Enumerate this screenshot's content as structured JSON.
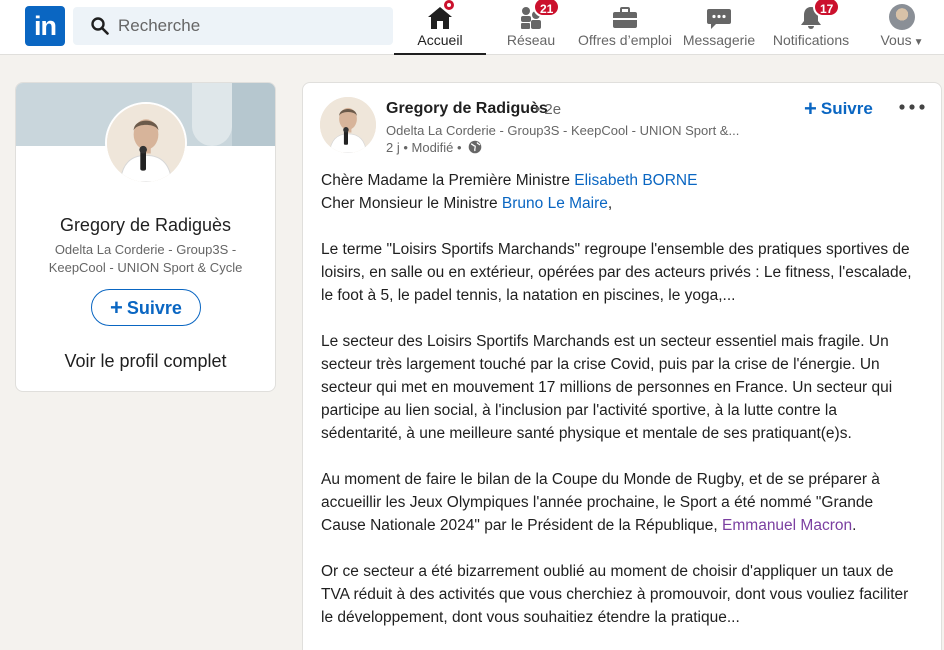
{
  "nav": {
    "search_placeholder": "Recherche",
    "items": [
      {
        "label": "Accueil",
        "icon": "home-icon",
        "active": true
      },
      {
        "label": "Réseau",
        "icon": "network-icon",
        "badge": "21"
      },
      {
        "label": "Offres d’emploi",
        "icon": "briefcase-icon"
      },
      {
        "label": "Messagerie",
        "icon": "messaging-icon"
      },
      {
        "label": "Notifications",
        "icon": "bell-icon",
        "badge": "17"
      },
      {
        "label": "Vous",
        "icon": "avatar-icon"
      }
    ]
  },
  "profile_card": {
    "name": "Gregory de Radiguès",
    "headline": "Odelta La Corderie - Group3S - KeepCool - UNION Sport & Cycle",
    "follow_label": "Suivre",
    "view_full_profile": "Voir le profil complet"
  },
  "post": {
    "author": "Gregory de Radiguès",
    "degree": "• 2e",
    "headline": "Odelta La Corderie - Group3S - KeepCool - UNION Sport &...",
    "meta": "2 j • Modifié •",
    "follow_label": "Suivre",
    "greeting_1_prefix": "Chère Madame la Première Ministre ",
    "greeting_1_mention": "Elisabeth BORNE",
    "greeting_2_prefix": "Cher Monsieur le Ministre ",
    "greeting_2_mention": "Bruno Le Maire",
    "greeting_2_suffix": ",",
    "paragraph_1": "Le terme \"Loisirs Sportifs Marchands\" regroupe l'ensemble des pratiques sportives de loisirs, en salle ou en extérieur, opérées par des acteurs privés : Le fitness, l'escalade, le foot à 5, le padel tennis, la natation en piscines, le yoga,...",
    "paragraph_2": "Le secteur des Loisirs Sportifs Marchands est un secteur essentiel mais fragile. Un secteur très largement touché par la crise Covid, puis par la crise de l'énergie. Un secteur qui met en mouvement 17 millions de personnes en France. Un secteur qui participe au lien social, à l'inclusion par l'activité sportive, à la lutte contre la sédentarité, à une meilleure santé physique et mentale de ses pratiquant(e)s.",
    "paragraph_3_text": "Au moment de faire le bilan de la Coupe du Monde de Rugby, et de se préparer à accueillir les Jeux Olympiques l'année prochaine, le Sport a été nommé \"Grande Cause Nationale 2024\" par le Président de la République, ",
    "paragraph_3_mention": "Emmanuel Macron",
    "paragraph_3_suffix": ".",
    "paragraph_4": "Or ce secteur a été bizarrement oublié au moment de choisir d'appliquer un taux de TVA réduit à des activités que vous cherchiez à promouvoir, dont vous vouliez faciliter le développement, dont vous souhaitiez étendre la pratique..."
  },
  "colors": {
    "brand": "#0a66c2",
    "badge": "#cb112d",
    "visited_mention": "#7b3fa1",
    "page_bg": "#f4f2ee"
  }
}
